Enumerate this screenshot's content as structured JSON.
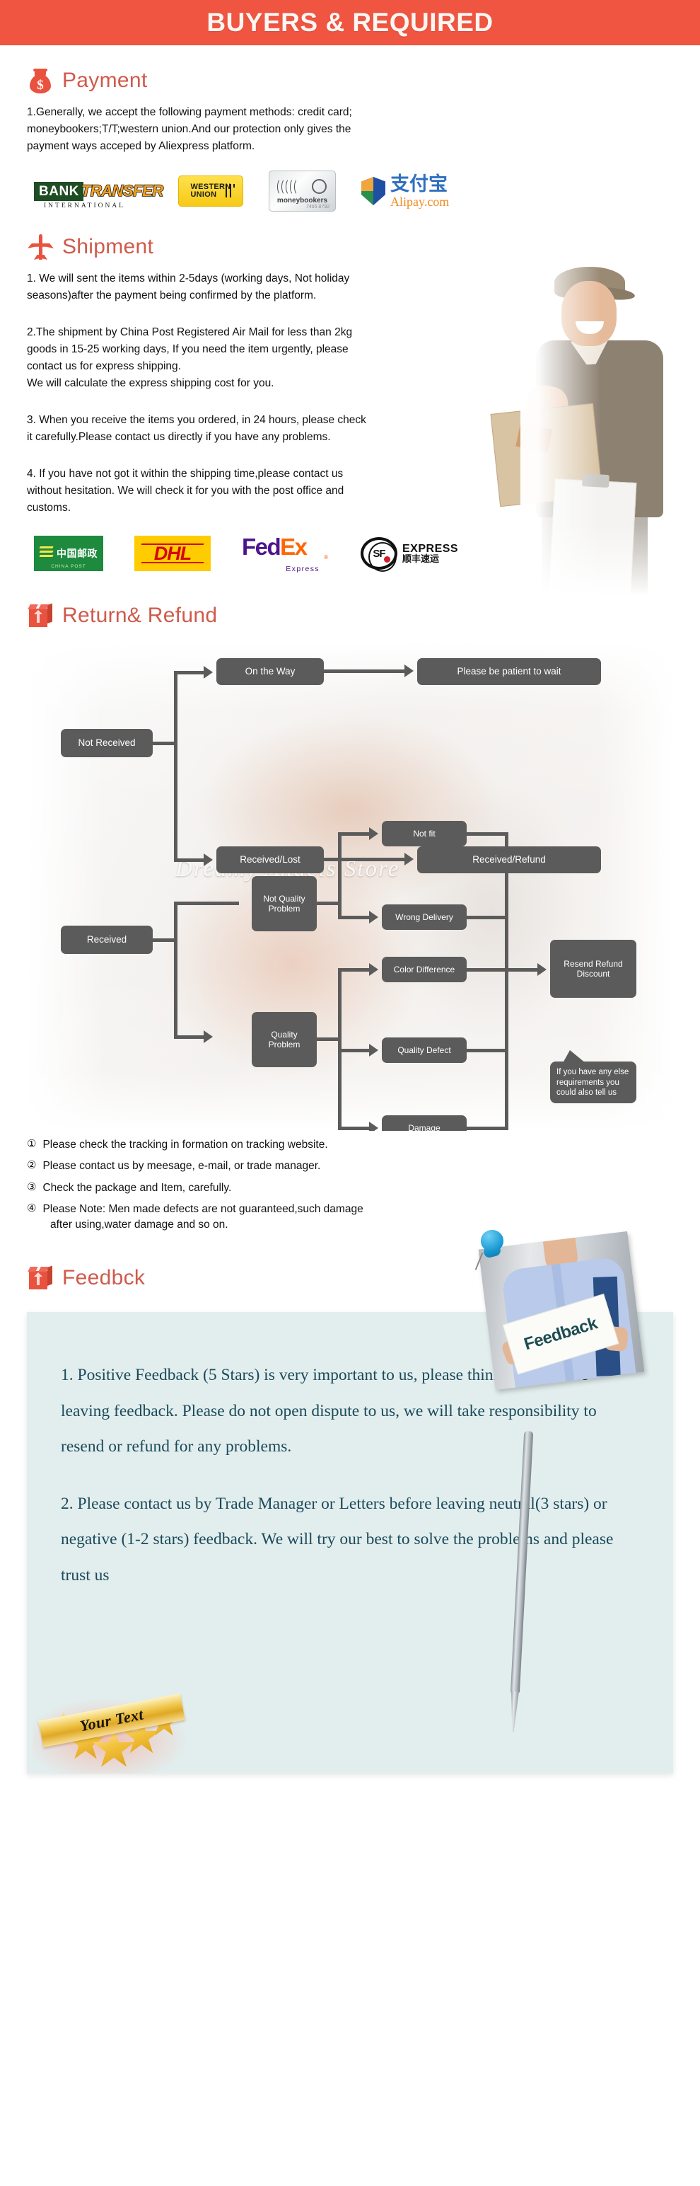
{
  "header": {
    "title": "BUYERS & REQUIRED"
  },
  "payment": {
    "heading": "Payment",
    "icon": "money-bag-icon",
    "body_line1": "1.Generally, we accept the following payment methods: credit card;",
    "body_line2": "moneybookers;T/T;western union.And our protection only gives the",
    "body_line3": "payment ways acceped by Aliexpress platform.",
    "logos": [
      {
        "name": "bank-transfer",
        "primary": "BANK",
        "secondary": "TRANSFER",
        "sub": "INTERNATIONAL"
      },
      {
        "name": "western-union",
        "line1": "WESTERN",
        "line2": "UNION"
      },
      {
        "name": "moneybookers",
        "label": "moneybookers",
        "number": "7465 8792"
      },
      {
        "name": "alipay",
        "cn": "支付宝",
        "en": "Alipay.com"
      }
    ]
  },
  "shipment": {
    "heading": "Shipment",
    "icon": "airplane-icon",
    "p1_line1": "1. We will sent the items within 2-5days (working days, Not holiday",
    "p1_line2": "seasons)after the payment being confirmed by the platform.",
    "p2_line1": "2.The shipment by China Post Registered Air Mail for less than  2kg",
    "p2_line2": "goods in 15-25 working days, If  you need the item urgently, please",
    "p2_line3": "contact us for express shipping.",
    "p2_line4": "We will calculate the express shipping cost for you.",
    "p3_line1": "3. When you receive the items you ordered, in 24 hours, please check",
    "p3_line2": " it carefully.Please contact us directly if you have any problems.",
    "p4_line1": "4. If you have not got it within the shipping time,please contact us",
    "p4_line2": "without hesitation. We will check it for you with the post office and",
    "p4_line3": "customs.",
    "couriers": [
      {
        "name": "china-post",
        "cn": "中国邮政",
        "en": "CHINA POST"
      },
      {
        "name": "dhl",
        "label": "DHL"
      },
      {
        "name": "fedex",
        "part1": "Fed",
        "part2": "Ex",
        "sub": "Express",
        "mark": "®"
      },
      {
        "name": "sf-express",
        "mark": "SF",
        "en": "EXPRESS",
        "cn": "顺丰速运"
      }
    ]
  },
  "returns": {
    "heading": "Return& Refund",
    "icon": "return-box-icon",
    "watermark": "Dreamy Angels Store",
    "nodes": {
      "not_received": "Not Received",
      "on_the_way": "On the Way",
      "please_wait": "Please be patient to wait",
      "received_lost": "Received/Lost",
      "received_refund": "Received/Refund",
      "received": "Received",
      "not_quality_problem": "Not Quality Problem",
      "quality_problem": "Quality Problem",
      "not_fit": "Not fit",
      "wrong_delivery": "Wrong Delivery",
      "color_difference": "Color Difference",
      "quality_defect": "Quality Defect",
      "damage": "Damage",
      "resend_refund_discount": "Resend Refund Discount",
      "bubble": "If you have any else requirements you could also tell us"
    },
    "notes": [
      {
        "num": "①",
        "text": "Please check the tracking in formation on tracking website."
      },
      {
        "num": "②",
        "text": "Please contact us by meesage, e-mail, or trade manager."
      },
      {
        "num": "③",
        "text": "Check the package and Item, carefully."
      },
      {
        "num": "④",
        "text": "Please Note: Men made defects  are not guaranteed,such damage"
      }
    ],
    "note4_cont": "after using,water damage and so on."
  },
  "feedback": {
    "heading": "Feedbck",
    "icon": "return-box-icon",
    "photo_card_text": "Feedback",
    "pin_icon": "pushpin-icon",
    "p1": "1. Positive Feedback (5 Stars) is very important to us, please think twice before leaving feedback. Please do not open dispute to us,   we will take responsibility to resend or refund for any problems.",
    "p2": "2. Please contact us by Trade Manager or Letters before leaving neutral(3 stars) or negative (1-2 stars) feedback. We will try our best to solve the problems and please trust us",
    "badge_text": "Your Text"
  },
  "colors": {
    "banner_red": "#ef5540",
    "heading_red": "#cf5a4c",
    "node_gray": "#5b5b5b",
    "panel_mint": "#e2eeee",
    "feedback_text": "#1c4a5a"
  }
}
